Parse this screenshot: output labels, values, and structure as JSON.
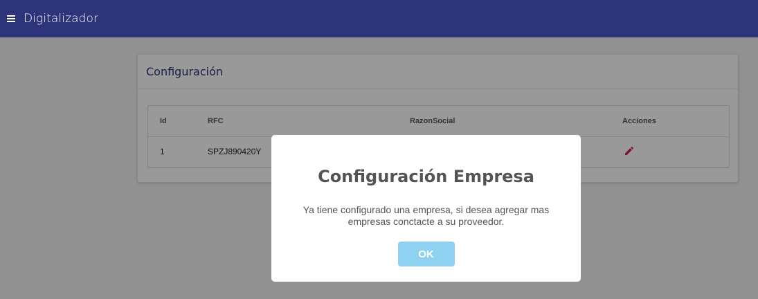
{
  "appbar": {
    "title": "Digitalizador",
    "menu_icon": "hamburger-menu-icon",
    "background_color": "#2d3479"
  },
  "card": {
    "title": "Configuración",
    "table": {
      "headers": [
        "Id",
        "RFC",
        "RazonSocial",
        "Acciones"
      ],
      "rows": [
        {
          "id": "1",
          "rfc": "SPZJ890420Y",
          "razon_social": "",
          "action_icon": "edit-pencil-icon"
        }
      ]
    }
  },
  "modal": {
    "title": "Configuración Empresa",
    "message": "Ya tiene configurado una empresa, si desea agregar mas empresas conctacte a su proveedor.",
    "ok_label": "OK",
    "ok_color": "#8fd1f1"
  },
  "colors": {
    "edit_icon": "#d81b60",
    "card_title": "#2d3479"
  }
}
